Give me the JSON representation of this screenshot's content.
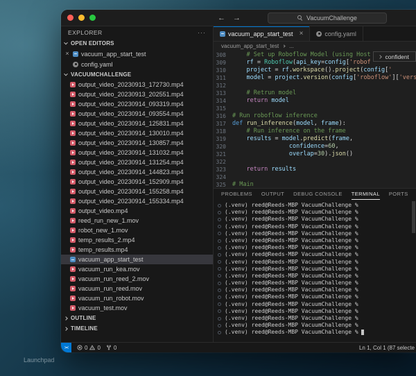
{
  "desktop": {
    "launchpad_label": "Launchpad"
  },
  "titlebar": {
    "back_icon": "←",
    "forward_icon": "→",
    "search_label": "VacuumChallenge"
  },
  "sidebar": {
    "title": "EXPLORER",
    "more_icon": "···",
    "open_editors_label": "OPEN EDITORS",
    "project_label": "VACUUMCHALLENGE",
    "outline_label": "OUTLINE",
    "timeline_label": "TIMELINE",
    "open_editors": [
      {
        "name": "vacuum_app_start_test",
        "icon": "file-blue",
        "close": "×"
      },
      {
        "name": "config.yaml",
        "icon": "yaml",
        "close": ""
      }
    ],
    "files": [
      {
        "name": "output_video_20230913_172730.mp4",
        "icon": "video",
        "selected": false
      },
      {
        "name": "output_video_20230913_202551.mp4",
        "icon": "video",
        "selected": false
      },
      {
        "name": "output_video_20230914_093319.mp4",
        "icon": "video",
        "selected": false
      },
      {
        "name": "output_video_20230914_093554.mp4",
        "icon": "video",
        "selected": false
      },
      {
        "name": "output_video_20230914_125831.mp4",
        "icon": "video",
        "selected": false
      },
      {
        "name": "output_video_20230914_130010.mp4",
        "icon": "video",
        "selected": false
      },
      {
        "name": "output_video_20230914_130857.mp4",
        "icon": "video",
        "selected": false
      },
      {
        "name": "output_video_20230914_131032.mp4",
        "icon": "video",
        "selected": false
      },
      {
        "name": "output_video_20230914_131254.mp4",
        "icon": "video",
        "selected": false
      },
      {
        "name": "output_video_20230914_144823.mp4",
        "icon": "video",
        "selected": false
      },
      {
        "name": "output_video_20230914_152909.mp4",
        "icon": "video",
        "selected": false
      },
      {
        "name": "output_video_20230914_155258.mp4",
        "icon": "video",
        "selected": false
      },
      {
        "name": "output_video_20230914_155334.mp4",
        "icon": "video",
        "selected": false
      },
      {
        "name": "output_video.mp4",
        "icon": "video",
        "selected": false
      },
      {
        "name": "reed_run_new_1.mov",
        "icon": "video",
        "selected": false
      },
      {
        "name": "robot_new_1.mov",
        "icon": "video",
        "selected": false
      },
      {
        "name": "temp_results_2.mp4",
        "icon": "video",
        "selected": false
      },
      {
        "name": "temp_results.mp4",
        "icon": "video",
        "selected": false
      },
      {
        "name": "vacuum_app_start_test",
        "icon": "file-blue",
        "selected": true
      },
      {
        "name": "vacuum_run_kea.mov",
        "icon": "video",
        "selected": false
      },
      {
        "name": "vacuum_run_reed_2.mov",
        "icon": "video",
        "selected": false
      },
      {
        "name": "vacuum_run_reed.mov",
        "icon": "video",
        "selected": false
      },
      {
        "name": "vacuum_run_robot.mov",
        "icon": "video",
        "selected": false
      },
      {
        "name": "vacuum_test.mov",
        "icon": "video",
        "selected": false
      }
    ]
  },
  "editor": {
    "tabs": [
      {
        "label": "vacuum_app_start_test",
        "icon": "file-blue",
        "active": true,
        "close": "×"
      },
      {
        "label": "config.yaml",
        "icon": "yaml",
        "active": false,
        "close": ""
      }
    ],
    "breadcrumb": {
      "file": "vacuum_app_start_test",
      "more": "..."
    },
    "suggestion_label": "confident",
    "code": [
      {
        "n": "308",
        "s": [
          [
            "    ",
            "pl"
          ],
          [
            "# Set up Roboflow Model (using Host",
            "cm"
          ]
        ]
      },
      {
        "n": "309",
        "s": [
          [
            "    ",
            "pl"
          ],
          [
            "rf",
            "var"
          ],
          [
            " = ",
            "pl"
          ],
          [
            "Roboflow",
            "cls"
          ],
          [
            "(",
            "pl"
          ],
          [
            "api_key",
            "var"
          ],
          [
            "=",
            "pl"
          ],
          [
            "config",
            "var"
          ],
          [
            "[",
            "pl"
          ],
          [
            "'robof",
            "str"
          ]
        ]
      },
      {
        "n": "310",
        "s": [
          [
            "    ",
            "pl"
          ],
          [
            "project",
            "var"
          ],
          [
            " = ",
            "pl"
          ],
          [
            "rf",
            "var"
          ],
          [
            ".",
            "pl"
          ],
          [
            "workspace",
            "fn"
          ],
          [
            "().",
            "pl"
          ],
          [
            "project",
            "fn"
          ],
          [
            "(",
            "pl"
          ],
          [
            "config",
            "var"
          ],
          [
            "[",
            "pl"
          ],
          [
            "'",
            "str"
          ]
        ]
      },
      {
        "n": "311",
        "s": [
          [
            "    ",
            "pl"
          ],
          [
            "model",
            "var"
          ],
          [
            " = ",
            "pl"
          ],
          [
            "project",
            "var"
          ],
          [
            ".",
            "pl"
          ],
          [
            "version",
            "fn"
          ],
          [
            "(",
            "pl"
          ],
          [
            "config",
            "var"
          ],
          [
            "[",
            "pl"
          ],
          [
            "'roboflow'",
            "str"
          ],
          [
            "][",
            "pl"
          ],
          [
            "'version",
            "str"
          ]
        ]
      },
      {
        "n": "312",
        "s": []
      },
      {
        "n": "313",
        "s": [
          [
            "    ",
            "pl"
          ],
          [
            "# Retrun model",
            "cm"
          ]
        ]
      },
      {
        "n": "314",
        "s": [
          [
            "    ",
            "pl"
          ],
          [
            "return",
            "kw"
          ],
          [
            " ",
            "pl"
          ],
          [
            "model",
            "var"
          ]
        ]
      },
      {
        "n": "315",
        "s": []
      },
      {
        "n": "316",
        "s": [
          [
            "# Run roboflow inference",
            "cm"
          ]
        ]
      },
      {
        "n": "317",
        "s": [
          [
            "def",
            "kw2"
          ],
          [
            " ",
            "pl"
          ],
          [
            "run_inference",
            "fn"
          ],
          [
            "(",
            "pl"
          ],
          [
            "model",
            "var"
          ],
          [
            ", ",
            "pl"
          ],
          [
            "frame",
            "var"
          ],
          [
            "):",
            "pl"
          ]
        ]
      },
      {
        "n": "318",
        "s": [
          [
            "    ",
            "pl"
          ],
          [
            "# Run inference on the frame",
            "cm"
          ]
        ]
      },
      {
        "n": "319",
        "s": [
          [
            "    ",
            "pl"
          ],
          [
            "results",
            "var"
          ],
          [
            " = ",
            "pl"
          ],
          [
            "model",
            "var"
          ],
          [
            ".",
            "pl"
          ],
          [
            "predict",
            "fn"
          ],
          [
            "(",
            "pl"
          ],
          [
            "frame",
            "var"
          ],
          [
            ",",
            "pl"
          ]
        ]
      },
      {
        "n": "320",
        "s": [
          [
            "                ",
            "pl"
          ],
          [
            "confidence",
            "var"
          ],
          [
            "=",
            "pl"
          ],
          [
            "60",
            "num"
          ],
          [
            ",",
            "pl"
          ]
        ]
      },
      {
        "n": "321",
        "s": [
          [
            "                ",
            "pl"
          ],
          [
            "overlap",
            "var"
          ],
          [
            "=",
            "pl"
          ],
          [
            "30",
            "num"
          ],
          [
            ").",
            "pl"
          ],
          [
            "json",
            "fn"
          ],
          [
            "()",
            "pl"
          ]
        ]
      },
      {
        "n": "322",
        "s": []
      },
      {
        "n": "323",
        "s": [
          [
            "    ",
            "pl"
          ],
          [
            "return",
            "kw"
          ],
          [
            " ",
            "pl"
          ],
          [
            "results",
            "var"
          ]
        ]
      },
      {
        "n": "324",
        "s": []
      },
      {
        "n": "325",
        "s": [
          [
            "# Main",
            "cm"
          ]
        ]
      }
    ]
  },
  "panel": {
    "tabs": [
      {
        "label": "PROBLEMS",
        "active": false
      },
      {
        "label": "OUTPUT",
        "active": false
      },
      {
        "label": "DEBUG CONSOLE",
        "active": false
      },
      {
        "label": "TERMINAL",
        "active": true
      },
      {
        "label": "PORTS",
        "active": false
      }
    ],
    "terminal_lines": [
      "(.venv) reed@Reeds-MBP VacuumChallenge %",
      "(.venv) reed@Reeds-MBP VacuumChallenge %",
      "(.venv) reed@Reeds-MBP VacuumChallenge %",
      "(.venv) reed@Reeds-MBP VacuumChallenge %",
      "(.venv) reed@Reeds-MBP VacuumChallenge %",
      "(.venv) reed@Reeds-MBP VacuumChallenge %",
      "(.venv) reed@Reeds-MBP VacuumChallenge %",
      "(.venv) reed@Reeds-MBP VacuumChallenge %",
      "(.venv) reed@Reeds-MBP VacuumChallenge %",
      "(.venv) reed@Reeds-MBP VacuumChallenge %",
      "(.venv) reed@Reeds-MBP VacuumChallenge %",
      "(.venv) reed@Reeds-MBP VacuumChallenge %",
      "(.venv) reed@Reeds-MBP VacuumChallenge %",
      "(.venv) reed@Reeds-MBP VacuumChallenge %",
      "(.venv) reed@Reeds-MBP VacuumChallenge %",
      "(.venv) reed@Reeds-MBP VacuumChallenge %",
      "(.venv) reed@Reeds-MBP VacuumChallenge %",
      "(.venv) reed@Reeds-MBP VacuumChallenge %",
      "(.venv) reed@Reeds-MBP VacuumChallenge %"
    ]
  },
  "statusbar": {
    "remote_label": "><",
    "errors": "0",
    "warnings": "0",
    "forks": "0",
    "cursor_position": "Ln 1, Col 1 (87 selecte"
  }
}
